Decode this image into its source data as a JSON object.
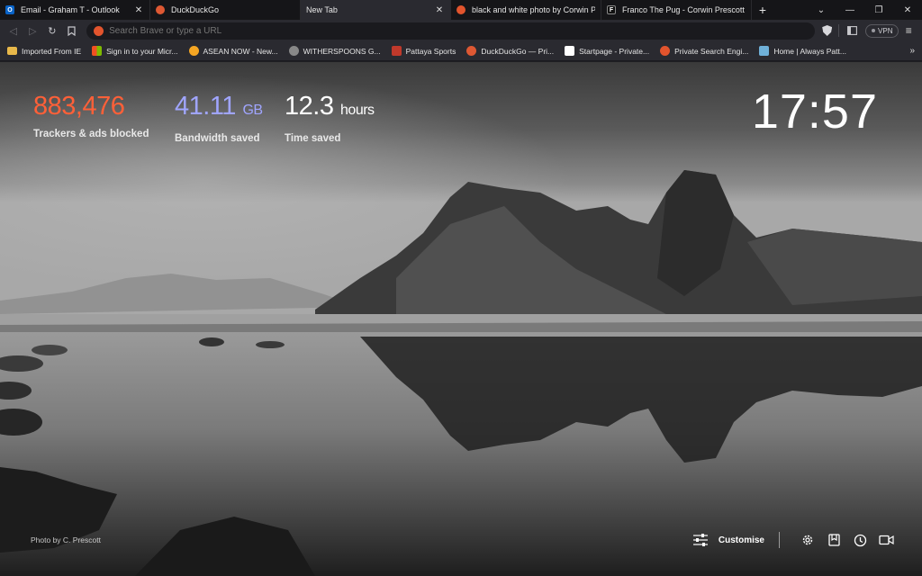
{
  "tabs": [
    {
      "title": "Email - Graham T - Outlook",
      "favicon": "outlook-icon",
      "color": "#0a64c8",
      "active": false
    },
    {
      "title": "DuckDuckGo",
      "favicon": "duckduckgo-icon",
      "color": "#de5833",
      "active": false
    },
    {
      "title": "New Tab",
      "favicon": "",
      "color": "",
      "active": true
    },
    {
      "title": "black and white photo by Corwin Pre",
      "favicon": "brave-search-icon",
      "color": "#e2542d",
      "active": false
    },
    {
      "title": "Franco The Pug - Corwin Prescott - F",
      "favicon": "corwin-site-icon",
      "color": "#111111",
      "active": false
    }
  ],
  "window_controls": {
    "new_tab": "+",
    "dropdown": "⌄",
    "minimize": "—",
    "restore": "❐",
    "close": "✕"
  },
  "toolbar": {
    "back": "◁",
    "forward": "▷",
    "reload": "↻",
    "bookmark": "🔖",
    "url_placeholder": "Search Brave or type a URL",
    "vpn_label": "VPN",
    "menu": "≡"
  },
  "bookmarks": [
    {
      "label": "Imported From IE",
      "icon": "folder-icon",
      "color": "#e8b84a"
    },
    {
      "label": "Sign in to your Micr...",
      "icon": "microsoft-icon",
      "color": "#f25022"
    },
    {
      "label": "ASEAN NOW - New...",
      "icon": "asean-icon",
      "color": "#f5a623"
    },
    {
      "label": "WITHERSPOONS G...",
      "icon": "globe-icon",
      "color": "#888888"
    },
    {
      "label": "Pattaya Sports",
      "icon": "pattaya-icon",
      "color": "#c0392b"
    },
    {
      "label": "DuckDuckGo — Pri...",
      "icon": "duckduckgo-icon",
      "color": "#de5833"
    },
    {
      "label": "Startpage - Private...",
      "icon": "startpage-icon",
      "color": "#ffffff"
    },
    {
      "label": "Private Search Engi...",
      "icon": "brave-search-icon",
      "color": "#e2542d"
    },
    {
      "label": "Home | Always Patt...",
      "icon": "home-site-icon",
      "color": "#6fb0d8"
    }
  ],
  "bookmarks_more": "»",
  "stats": {
    "trackers": {
      "value": "883,476",
      "label": "Trackers & ads blocked",
      "color": "#ff6038"
    },
    "bandwidth": {
      "value": "41.11",
      "unit": "GB",
      "label": "Bandwidth saved",
      "color": "#a0a5ff"
    },
    "time": {
      "value": "12.3",
      "unit": "hours",
      "label": "Time saved",
      "color": "#ffffff"
    }
  },
  "clock": "17:57",
  "photo_credit": "Photo by C. Prescott",
  "customise_label": "Customise"
}
